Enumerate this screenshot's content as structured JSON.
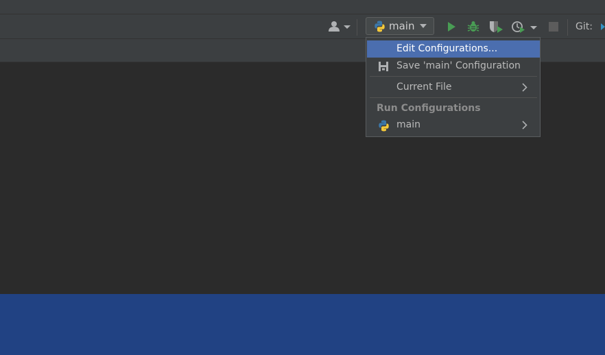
{
  "toolbar": {
    "run_config": {
      "label": "main",
      "icon": "python-icon"
    },
    "git_label": "Git:",
    "icons": {
      "account": "user-icon",
      "run": "play-icon",
      "debug": "bug-icon",
      "coverage": "coverage-icon",
      "profile": "profiler-icon",
      "stop": "stop-icon"
    }
  },
  "menu": {
    "items": [
      {
        "label": "Edit Configurations...",
        "selected": true
      },
      {
        "label": "Save 'main' Configuration",
        "icon": "save-icon"
      },
      {
        "label": "Current File",
        "submenu": true
      }
    ],
    "section_header": "Run Configurations",
    "run_configs": [
      {
        "label": "main",
        "icon": "python-icon",
        "submenu": true
      }
    ]
  },
  "colors": {
    "accent_selection": "#4b6eaf",
    "run_green": "#499c54",
    "bottom_panel": "#214283"
  }
}
